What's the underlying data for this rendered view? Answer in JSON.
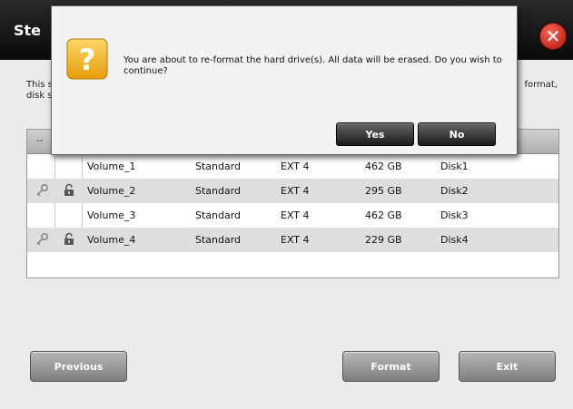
{
  "wizard": {
    "title_partial": "Ste",
    "close_label": "✕",
    "desc_line1_left": "This s",
    "desc_line2_left": "disk s",
    "desc_line1_right": "format,",
    "table_header_dash": "--",
    "rows": [
      {
        "name": "Volume_1",
        "type": "Standard",
        "fs": "EXT 4",
        "size": "462 GB",
        "disk": "Disk1",
        "icons": false
      },
      {
        "name": "Volume_2",
        "type": "Standard",
        "fs": "EXT 4",
        "size": "295 GB",
        "disk": "Disk2",
        "icons": true
      },
      {
        "name": "Volume_3",
        "type": "Standard",
        "fs": "EXT 4",
        "size": "462 GB",
        "disk": "Disk3",
        "icons": false
      },
      {
        "name": "Volume_4",
        "type": "Standard",
        "fs": "EXT 4",
        "size": "229 GB",
        "disk": "Disk4",
        "icons": true
      }
    ],
    "buttons": {
      "previous": "Previous",
      "format": "Format",
      "exit": "Exit"
    }
  },
  "dialog": {
    "message": "You are about to re-format the hard drive(s). All data will be erased. Do you wish to continue?",
    "yes": "Yes",
    "no": "No",
    "icon": "question-mark-icon"
  },
  "colors": {
    "header": "#111111",
    "close": "#d8392c",
    "dialog_button": "#333333",
    "wizard_button": "#9a9a9a",
    "icon_yellow": "#f2b51c"
  }
}
